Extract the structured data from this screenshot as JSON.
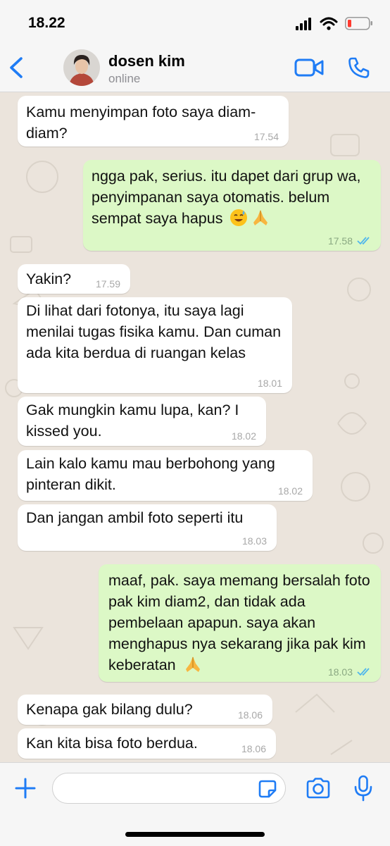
{
  "status_bar": {
    "time": "18.22",
    "icons": [
      "signal-icon",
      "wifi-icon",
      "battery-low-icon"
    ]
  },
  "header": {
    "back_icon": "chevron-left-icon",
    "contact_name": "dosen kim",
    "contact_status": "online",
    "actions": [
      "video-call-icon",
      "phone-icon"
    ],
    "accent_color": "#1f7cf5"
  },
  "messages": [
    {
      "direction": "in",
      "text": "Kamu menyimpan foto saya diam-diam?",
      "time": "17.54"
    },
    {
      "direction": "out",
      "text": "ngga pak, serius. itu dapet dari grup wa, penyimpanan saya otomatis. belum sempat saya hapus",
      "emojis": [
        "sweat-smile-emoji",
        "folded-hands-emoji"
      ],
      "time": "17.58",
      "read": true
    },
    {
      "direction": "in",
      "text": "Yakin?",
      "time": "17.59"
    },
    {
      "direction": "in",
      "text": "Di lihat dari fotonya, itu saya lagi menilai tugas fisika kamu. Dan cuman ada kita berdua di ruangan kelas",
      "time": "18.01"
    },
    {
      "direction": "in",
      "text": "Gak mungkin kamu lupa, kan? I kissed you.",
      "time": "18.02"
    },
    {
      "direction": "in",
      "text": "Lain kalo kamu mau berbohong yang pinteran dikit.",
      "time": "18.02"
    },
    {
      "direction": "in",
      "text": "Dan jangan ambil foto seperti itu",
      "time": "18.03"
    },
    {
      "direction": "out",
      "text": "maaf, pak. saya memang bersalah foto pak kim diam2, dan tidak ada pembelaan apapun. saya akan menghapus nya sekarang jika pak kim keberatan",
      "emojis": [
        "folded-hands-emoji"
      ],
      "time": "18.03",
      "read": true
    },
    {
      "direction": "in",
      "text": "Kenapa gak bilang dulu?",
      "time": "18.06"
    },
    {
      "direction": "in",
      "text": "Kan kita bisa foto berdua.",
      "time": "18.06"
    }
  ],
  "input_bar": {
    "placeholder": "",
    "icons": [
      "plus-icon",
      "sticker-icon",
      "camera-icon",
      "microphone-icon"
    ]
  },
  "colors": {
    "incoming_bubble": "#ffffff",
    "outgoing_bubble": "#dcf8c6",
    "chat_background": "#ebe4dc",
    "read_ticks": "#4fb6ec"
  }
}
